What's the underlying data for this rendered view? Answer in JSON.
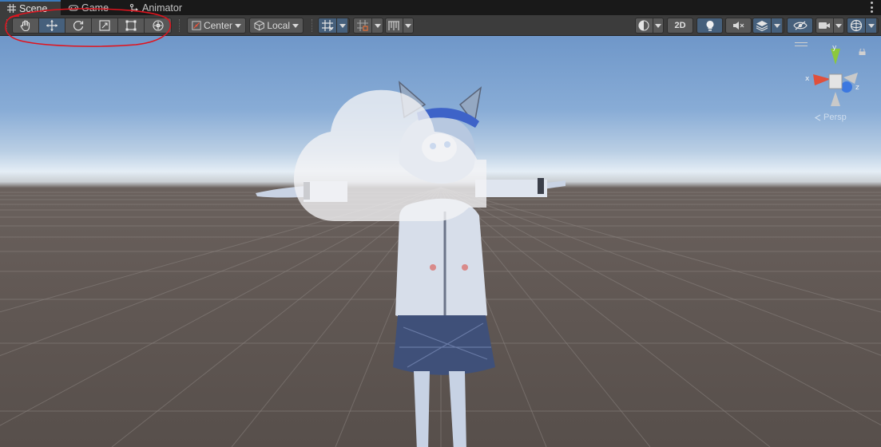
{
  "tabs": [
    {
      "label": "Scene",
      "icon": "grid-icon",
      "active": true
    },
    {
      "label": "Game",
      "icon": "gamepad-icon",
      "active": false
    },
    {
      "label": "Animator",
      "icon": "animator-icon",
      "active": false
    }
  ],
  "toolbar": {
    "transform_tools": [
      "hand-tool",
      "move-tool",
      "rotate-tool",
      "scale-tool",
      "rect-tool",
      "transform-tool"
    ],
    "active_tool": "move-tool",
    "pivot_mode": "Center",
    "pivot_rotation": "Local",
    "view_2d_label": "2D"
  },
  "scene": {
    "axis_x": "x",
    "axis_y": "y",
    "axis_z": "z",
    "projection_label": "Persp"
  },
  "colors": {
    "accent": "#3a79bb",
    "active_button": "#46607c",
    "annotation": "#e0141e",
    "axis_x": "#e0503c",
    "axis_y": "#8cc83c",
    "axis_z": "#3c78e0"
  }
}
